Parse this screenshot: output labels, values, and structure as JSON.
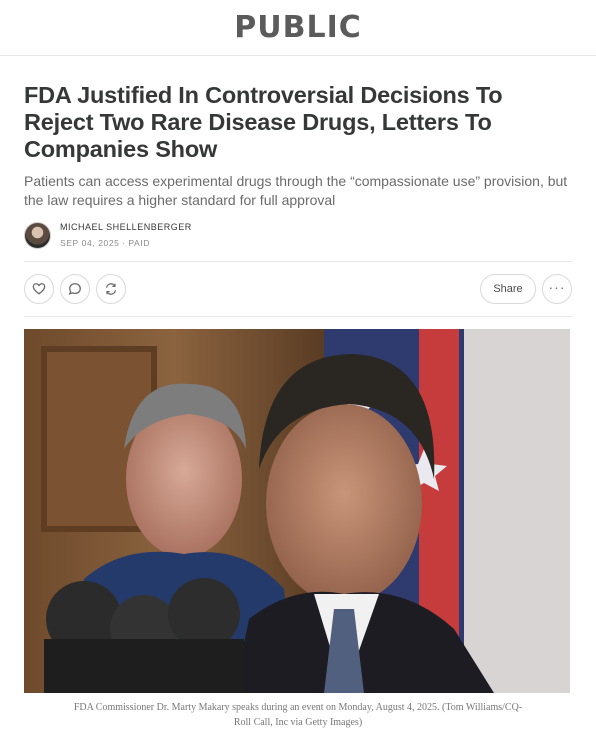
{
  "publication": {
    "name": "PUBLIC"
  },
  "article": {
    "title": "FDA Justified In Controversial Decisions To Reject Two Rare Disease Drugs, Letters To Companies Show",
    "subtitle": "Patients can access experimental drugs through the “compassionate use” provision, but the law requires a higher standard for full approval",
    "author": "MICHAEL SHELLENBERGER",
    "date": "SEP 04, 2025",
    "access": "PAID",
    "meta_separator": "∙"
  },
  "actions": {
    "like_icon": "heart-icon",
    "comment_icon": "comment-icon",
    "restack_icon": "restack-icon",
    "share_label": "Share",
    "more_label": "···"
  },
  "image": {
    "caption": "FDA Commissioner Dr. Marty Makary speaks during an event on Monday, August 4, 2025. (Tom Williams/CQ-Roll Call, Inc via Getty Images)"
  }
}
